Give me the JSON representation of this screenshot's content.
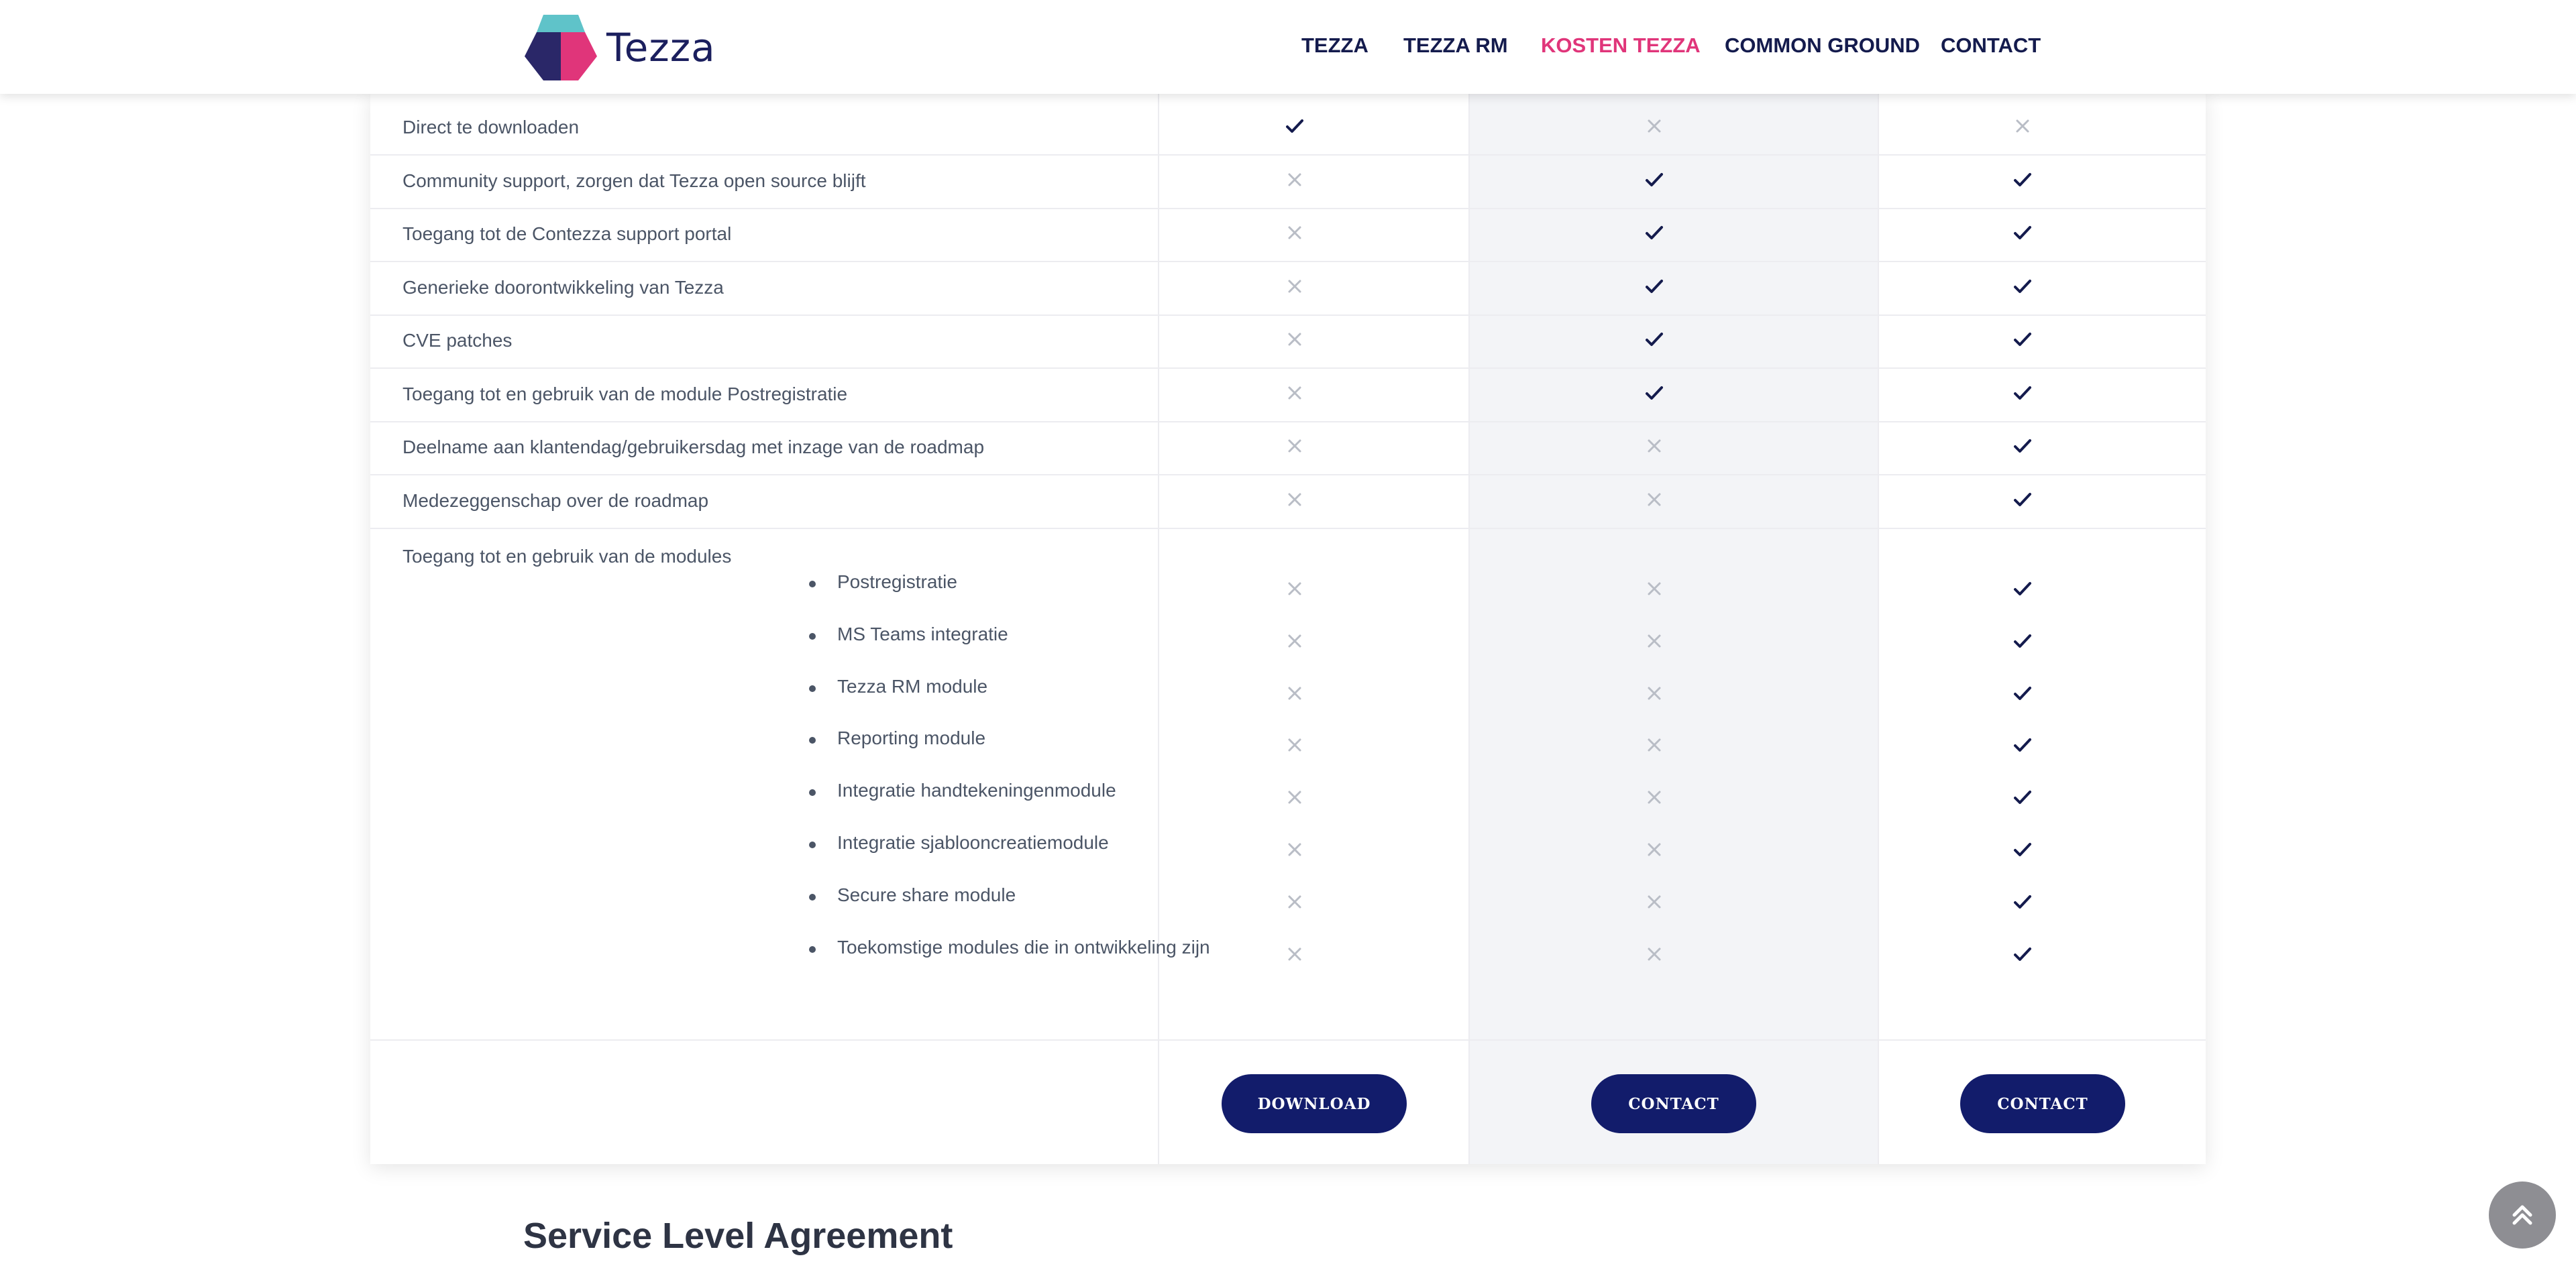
{
  "header": {
    "logo_text": "Tezza",
    "nav": [
      {
        "label": "TEZZA",
        "active": false
      },
      {
        "label": "TEZZA RM",
        "active": false
      },
      {
        "label": "KOSTEN TEZZA",
        "active": true
      },
      {
        "label": "COMMON GROUND",
        "active": false
      },
      {
        "label": "CONTACT",
        "active": false
      }
    ],
    "accent_color": "#e0357a",
    "brand_color": "#141b4d"
  },
  "table": {
    "rows": [
      {
        "label": "Direct te downloaden",
        "values": [
          "check",
          "cross",
          "cross"
        ]
      },
      {
        "label": "Community support, zorgen dat Tezza open source blijft",
        "values": [
          "cross",
          "check",
          "check"
        ]
      },
      {
        "label": "Toegang tot de Contezza support portal",
        "values": [
          "cross",
          "check",
          "check"
        ]
      },
      {
        "label": "Generieke doorontwikkeling van Tezza",
        "values": [
          "cross",
          "check",
          "check"
        ]
      },
      {
        "label": "CVE patches",
        "values": [
          "cross",
          "check",
          "check"
        ]
      },
      {
        "label": "Toegang tot en gebruik van de module Postregistratie",
        "values": [
          "cross",
          "check",
          "check"
        ]
      },
      {
        "label": "Deelname aan klantendag/gebruikersdag met inzage van de roadmap",
        "values": [
          "cross",
          "cross",
          "check"
        ]
      },
      {
        "label": "Medezeggenschap over de roadmap",
        "values": [
          "cross",
          "cross",
          "check"
        ]
      }
    ],
    "modules_heading": "Toegang tot en gebruik van de modules",
    "modules": [
      {
        "label": "Postregistratie",
        "values": [
          "cross",
          "cross",
          "check"
        ]
      },
      {
        "label": "MS Teams integratie",
        "values": [
          "cross",
          "cross",
          "check"
        ]
      },
      {
        "label": "Tezza RM module",
        "values": [
          "cross",
          "cross",
          "check"
        ]
      },
      {
        "label": "Reporting module",
        "values": [
          "cross",
          "cross",
          "check"
        ]
      },
      {
        "label": "Integratie handtekeningenmodule",
        "values": [
          "cross",
          "cross",
          "check"
        ]
      },
      {
        "label": "Integratie sjablooncreatiemodule",
        "values": [
          "cross",
          "cross",
          "check"
        ]
      },
      {
        "label": "Secure share module",
        "values": [
          "cross",
          "cross",
          "check"
        ]
      },
      {
        "label": "Toekomstige modules die in ontwikkeling zijn",
        "values": [
          "cross",
          "cross",
          "check"
        ]
      }
    ],
    "buttons": [
      "DOWNLOAD",
      "CONTACT",
      "CONTACT"
    ],
    "check_color": "#141b4d",
    "cross_color": "#b9bdc6",
    "button_color": "#121c6b"
  },
  "section_title": "Service Level Agreement",
  "scroll_top_icon": "chevron-double-up-icon"
}
